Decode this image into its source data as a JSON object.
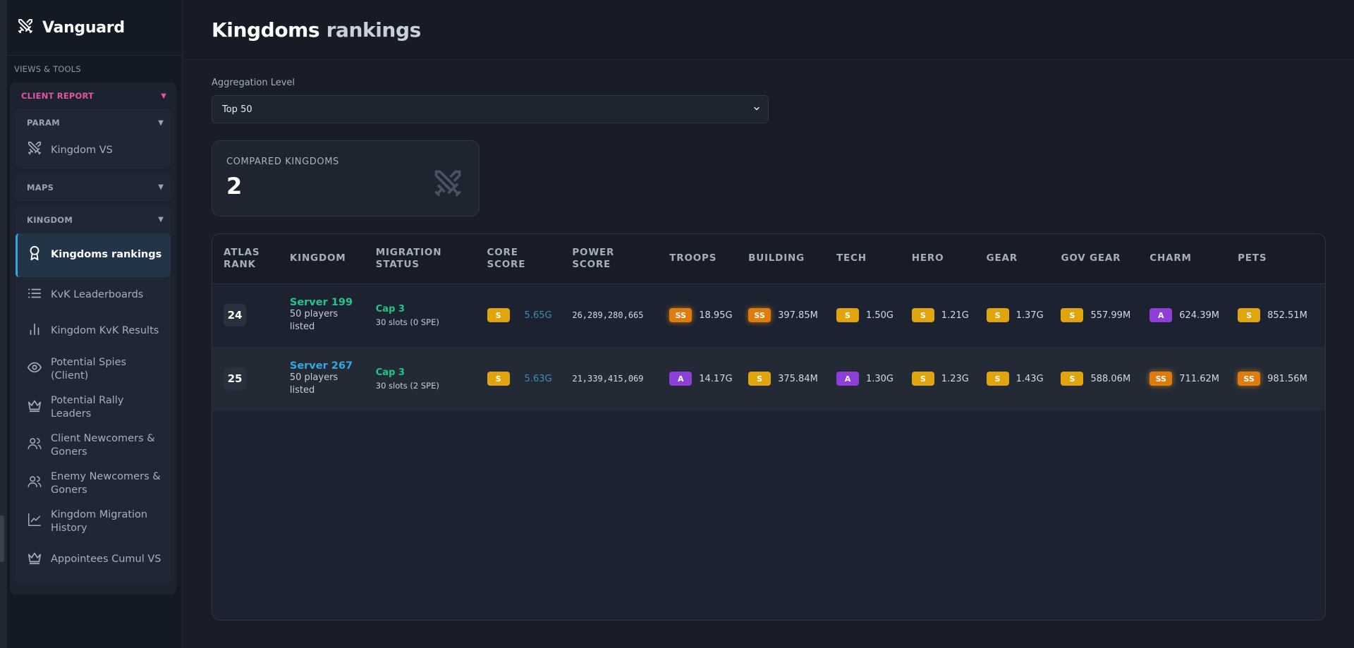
{
  "app": {
    "name": "Vanguard"
  },
  "sidebar": {
    "section_label": "VIEWS & TOOLS",
    "client_report": {
      "label": "CLIENT REPORT",
      "caret": "▼"
    },
    "groups": {
      "param": {
        "label": "PARAM",
        "caret": "▼",
        "items": [
          {
            "label": "Kingdom VS",
            "icon": "swords-icon"
          }
        ]
      },
      "maps": {
        "label": "MAPS",
        "caret": "▼"
      },
      "kingdom": {
        "label": "KINGDOM",
        "caret": "▼",
        "items": [
          {
            "label": "Kingdoms rankings",
            "icon": "award-icon",
            "active": true
          },
          {
            "label": "KvK Leaderboards",
            "icon": "list-icon"
          },
          {
            "label": "Kingdom KvK Results",
            "icon": "bar-chart-icon"
          },
          {
            "label": "Potential Spies (Client)",
            "icon": "eye-icon"
          },
          {
            "label": "Potential Rally Leaders",
            "icon": "crown-icon"
          },
          {
            "label": "Client Newcomers & Goners",
            "icon": "users-icon"
          },
          {
            "label": "Enemy Newcomers & Goners",
            "icon": "users-icon"
          },
          {
            "label": "Kingdom Migration History",
            "icon": "line-chart-icon"
          },
          {
            "label": "Appointees Cumul VS",
            "icon": "crown-icon"
          }
        ]
      }
    }
  },
  "page": {
    "title_main": "Kingdoms",
    "title_rest": "rankings",
    "aggregation": {
      "label": "Aggregation Level",
      "value": "Top 50"
    },
    "stat_card": {
      "label": "COMPARED KINGDOMS",
      "value": "2",
      "icon": "swords-icon"
    }
  },
  "table": {
    "columns": [
      [
        "ATLAS",
        "RANK"
      ],
      [
        "KINGDOM"
      ],
      [
        "MIGRATION",
        "STATUS"
      ],
      [
        "CORE",
        "SCORE"
      ],
      [
        "POWER",
        "SCORE"
      ],
      [
        "TROOPS"
      ],
      [
        "BUILDING"
      ],
      [
        "TECH"
      ],
      [
        "HERO"
      ],
      [
        "GEAR"
      ],
      [
        "GOV GEAR"
      ],
      [
        "CHARM"
      ],
      [
        "PETS"
      ]
    ],
    "rows": [
      {
        "rank": "24",
        "kingdom": {
          "name": "Server 199",
          "sub1": "50 players",
          "sub2": "listed",
          "color": "#22c58a"
        },
        "migration": {
          "cap": "Cap 3",
          "slots": "30 slots (0 SPE)"
        },
        "core": {
          "tier": "S",
          "value": "5.65G"
        },
        "power": "26,289,280,665",
        "troops": {
          "tier": "SS",
          "value": "18.95G"
        },
        "building": {
          "tier": "SS",
          "value": "397.85M"
        },
        "tech": {
          "tier": "S",
          "value": "1.50G"
        },
        "hero": {
          "tier": "S",
          "value": "1.21G"
        },
        "gear": {
          "tier": "S",
          "value": "1.37G"
        },
        "gov_gear": {
          "tier": "S",
          "value": "557.99M"
        },
        "charm": {
          "tier": "A",
          "value": "624.39M"
        },
        "pets": {
          "tier": "S",
          "value": "852.51M"
        }
      },
      {
        "rank": "25",
        "kingdom": {
          "name": "Server 267",
          "sub1": "50 players",
          "sub2": "listed",
          "color": "#35a7e0"
        },
        "migration": {
          "cap": "Cap 3",
          "slots": "30 slots (2 SPE)"
        },
        "core": {
          "tier": "S",
          "value": "5.63G"
        },
        "power": "21,339,415,069",
        "troops": {
          "tier": "A",
          "value": "14.17G"
        },
        "building": {
          "tier": "S",
          "value": "375.84M"
        },
        "tech": {
          "tier": "A",
          "value": "1.30G"
        },
        "hero": {
          "tier": "S",
          "value": "1.23G"
        },
        "gear": {
          "tier": "S",
          "value": "1.43G"
        },
        "gov_gear": {
          "tier": "S",
          "value": "588.06M"
        },
        "charm": {
          "tier": "SS",
          "value": "711.62M"
        },
        "pets": {
          "tier": "SS",
          "value": "981.56M"
        }
      }
    ]
  },
  "colors": {
    "accent_pink": "#e0569f",
    "accent_blue": "#35a7e0",
    "green": "#22c58a",
    "tier_S": "#e0a50d",
    "tier_SS": "#df7c0e",
    "tier_A": "#8f3fd9"
  }
}
